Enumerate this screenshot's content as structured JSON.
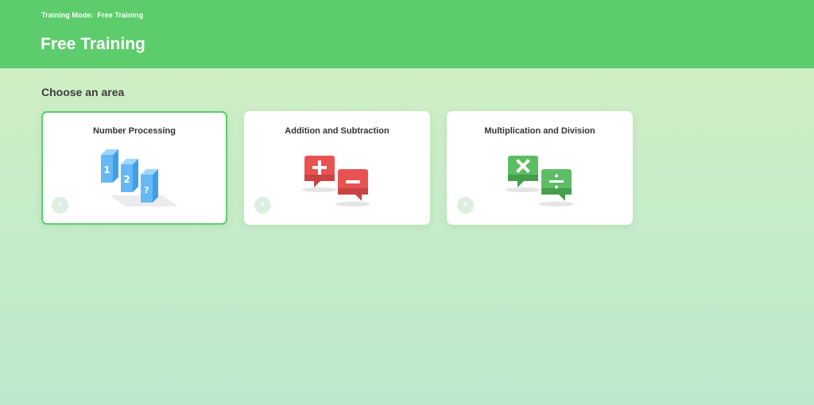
{
  "header": {
    "mode_label": "Training Mode:",
    "mode_value": "Free Training",
    "title": "Free Training"
  },
  "main": {
    "section_title": "Choose an area",
    "cards": [
      {
        "title": "Number Processing",
        "count": "0",
        "selected": true,
        "icon": "number-blocks-icon",
        "digits": [
          "1",
          "2",
          "?"
        ]
      },
      {
        "title": "Addition and Subtraction",
        "count": "0",
        "selected": false,
        "icon": "plus-minus-bubbles-icon"
      },
      {
        "title": "Multiplication and Division",
        "count": "0",
        "selected": false,
        "icon": "times-divide-bubbles-icon"
      }
    ]
  },
  "colors": {
    "header": "#5dcc6c",
    "selected_border": "#5dcc6c",
    "block_blue": "#64b8f5",
    "bubble_red": "#e85352",
    "bubble_green": "#5dbd64"
  }
}
